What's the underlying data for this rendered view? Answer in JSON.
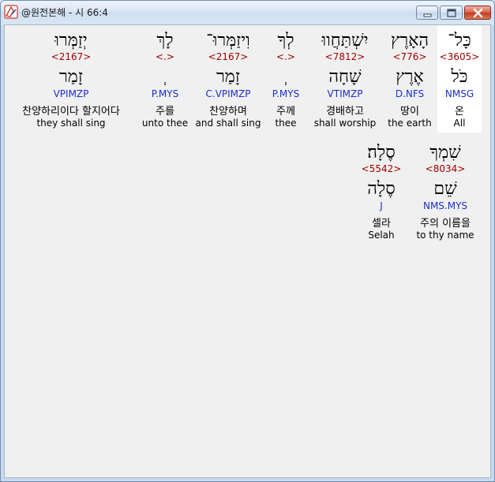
{
  "window": {
    "title": "@원전본해 - 시 66:4",
    "controls": {
      "minimize": "minimize-icon",
      "maximize": "maximize-icon",
      "close": "close-icon"
    }
  },
  "rows": [
    {
      "words": [
        {
          "heb": "כָּל־",
          "strong": "<3605>",
          "lemma": "כֹּל",
          "morph": "NMSG",
          "kor": "온",
          "eng": "All",
          "selected": true
        },
        {
          "heb": "הָאָרֶץ",
          "strong": "<776>",
          "lemma": "אֶרֶץ",
          "morph": "D.NFS",
          "kor": "땅이",
          "eng": "the earth"
        },
        {
          "heb": "יִשְׁתַּחֲווּ",
          "strong": "<7812>",
          "lemma": "שָׁחָה",
          "morph": "VTIMZP",
          "kor": "경배하고",
          "eng": "shall worship"
        },
        {
          "heb": "לְךָ",
          "strong": "<.>",
          "lemma": "ְ",
          "morph": "P.MYS",
          "kor": "주께",
          "eng": "thee"
        },
        {
          "heb": "וִיזַמְּרוּ־",
          "strong": "<2167>",
          "lemma": "זָמַר",
          "morph": "C.VPIMZP",
          "kor": "찬양하며",
          "eng": "and shall sing"
        },
        {
          "heb": "לָךְ",
          "strong": "<.>",
          "lemma": "ְ",
          "morph": "P.MYS",
          "kor": "주를",
          "eng": "unto thee"
        },
        {
          "heb": "יְזַמְּרוּ",
          "strong": "<2167>",
          "lemma": "זָמַר",
          "morph": "VPIMZP",
          "kor": "찬양하리이다 할지어다",
          "eng": "they shall sing"
        }
      ]
    },
    {
      "words": [
        {
          "heb": "שִׁמְךָ",
          "strong": "<8034>",
          "lemma": "שֵׁם",
          "morph": "NMS.MYS",
          "kor": "주의 이름을",
          "eng": "to thy name"
        },
        {
          "heb": "סֶלָה׃",
          "strong": "<5542>",
          "lemma": "סֶלָה",
          "morph": "J",
          "kor": "셀라",
          "eng": "Selah"
        }
      ]
    }
  ]
}
